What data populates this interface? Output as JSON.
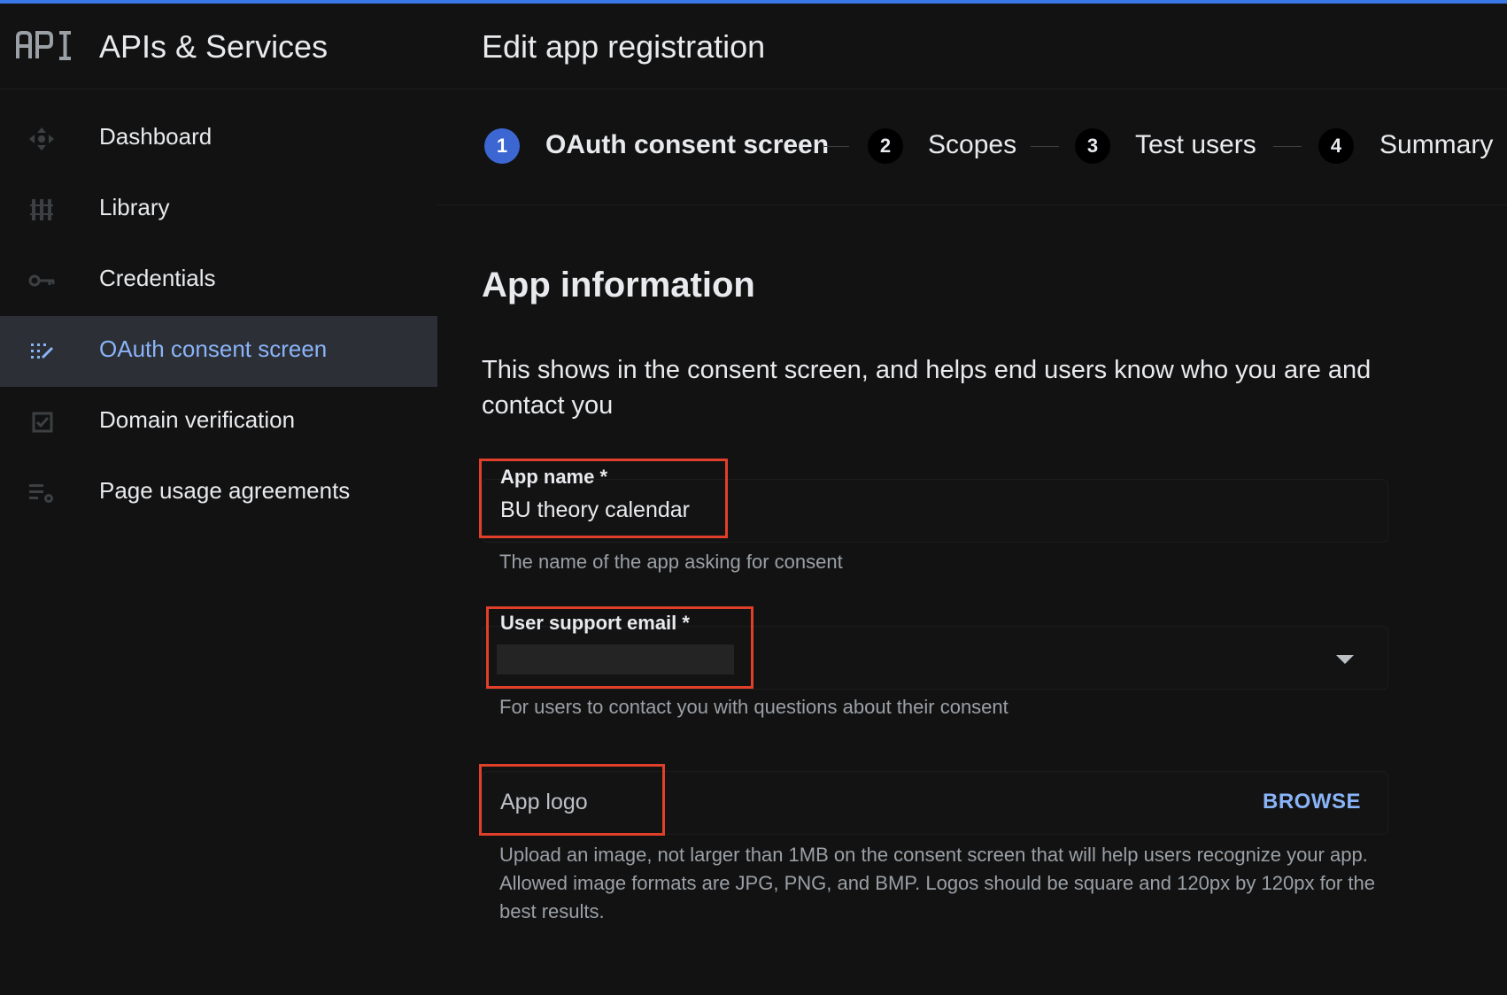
{
  "app": {
    "product_title": "APIs & Services",
    "page_title": "Edit app registration"
  },
  "sidebar": {
    "items": [
      {
        "label": "Dashboard",
        "icon": "dashboard-icon",
        "active": false
      },
      {
        "label": "Library",
        "icon": "library-icon",
        "active": false
      },
      {
        "label": "Credentials",
        "icon": "key-icon",
        "active": false
      },
      {
        "label": "OAuth consent screen",
        "icon": "consent-icon",
        "active": true
      },
      {
        "label": "Domain verification",
        "icon": "checkbox-icon",
        "active": false
      },
      {
        "label": "Page usage agreements",
        "icon": "settings-list-icon",
        "active": false
      }
    ]
  },
  "stepper": {
    "steps": [
      {
        "number": "1",
        "label": "OAuth consent screen",
        "active": true
      },
      {
        "number": "2",
        "label": "Scopes",
        "active": false
      },
      {
        "number": "3",
        "label": "Test users",
        "active": false
      },
      {
        "number": "4",
        "label": "Summary",
        "active": false
      }
    ]
  },
  "form": {
    "section_title": "App information",
    "section_description": "This shows in the consent screen, and helps end users know who you are and contact you",
    "app_name": {
      "label": "App name *",
      "value": "BU theory calendar",
      "helper": "The name of the app asking for consent"
    },
    "support_email": {
      "label": "User support email *",
      "value": "",
      "helper": "For users to contact you with questions about their consent"
    },
    "app_logo": {
      "placeholder": "App logo",
      "browse_label": "BROWSE",
      "helper": "Upload an image, not larger than 1MB on the consent screen that will help users recognize your app. Allowed image formats are JPG, PNG, and BMP. Logos should be square and 120px by 120px for the best results."
    }
  },
  "colors": {
    "accent": "#8ab4f8",
    "step_active": "#3c66d1",
    "highlight": "#e0402a",
    "top_bar": "#3b78e7"
  }
}
